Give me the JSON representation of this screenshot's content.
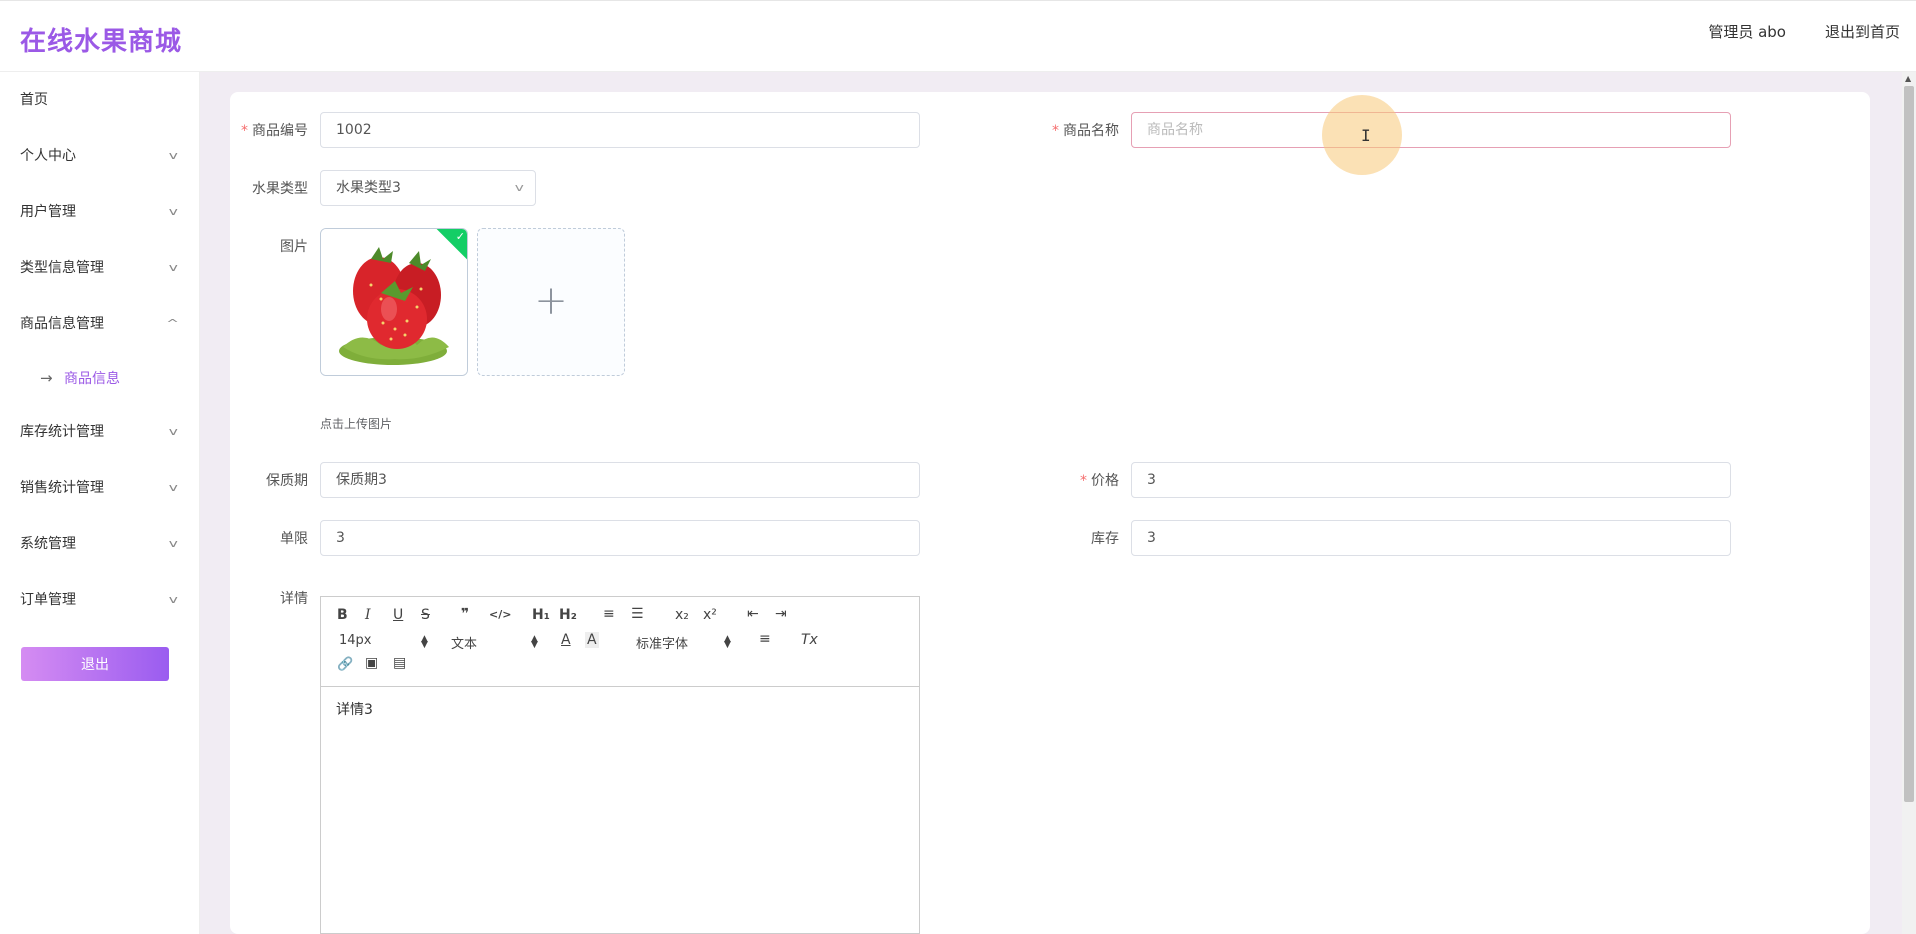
{
  "app": {
    "title": "在线水果商城"
  },
  "header": {
    "user_label": "管理员 abo",
    "back_label": "退出到首页"
  },
  "sidebar": {
    "items": [
      {
        "label": "首页"
      },
      {
        "label": "个人中心"
      },
      {
        "label": "用户管理"
      },
      {
        "label": "类型信息管理"
      },
      {
        "label": "商品信息管理"
      },
      {
        "label": "库存统计管理"
      },
      {
        "label": "销售统计管理"
      },
      {
        "label": "系统管理"
      },
      {
        "label": "订单管理"
      }
    ],
    "submenu": {
      "label": "商品信息",
      "arrow": "→"
    },
    "logout_label": "退出"
  },
  "form": {
    "product_no": {
      "label": "商品编号",
      "value": "1002"
    },
    "product_name": {
      "label": "商品名称",
      "placeholder": "商品名称"
    },
    "fruit_type": {
      "label": "水果类型",
      "value": "水果类型3"
    },
    "image": {
      "label": "图片",
      "hint": "点击上传图片",
      "add_symbol": "+"
    },
    "shelf_life": {
      "label": "保质期",
      "value": "保质期3"
    },
    "price": {
      "label": "价格",
      "value": "3"
    },
    "limit": {
      "label": "单限",
      "value": "3"
    },
    "stock": {
      "label": "库存",
      "value": "3"
    },
    "detail": {
      "label": "详情",
      "content": "详情3"
    },
    "required_mark": "*"
  },
  "editor_toolbar": {
    "bold": "B",
    "italic": "I",
    "underline": "U",
    "strike": "S",
    "blockquote": "❞",
    "code": "</>",
    "h1": "H₁",
    "h2": "H₂",
    "ordered_list": "≡",
    "bullet_list": "☰",
    "subscript": "x₂",
    "superscript": "x²",
    "outdent": "⇤",
    "indent": "⇥",
    "size": "14px",
    "header": "文本",
    "color": "A",
    "background": "A",
    "font": "标准字体",
    "align": "≡",
    "clean": "Tx",
    "link": "🔗",
    "image": "▣",
    "video": "▤"
  },
  "colors": {
    "brand": "#9b59e6",
    "required": "#f56c6c",
    "success": "#13ce66"
  }
}
